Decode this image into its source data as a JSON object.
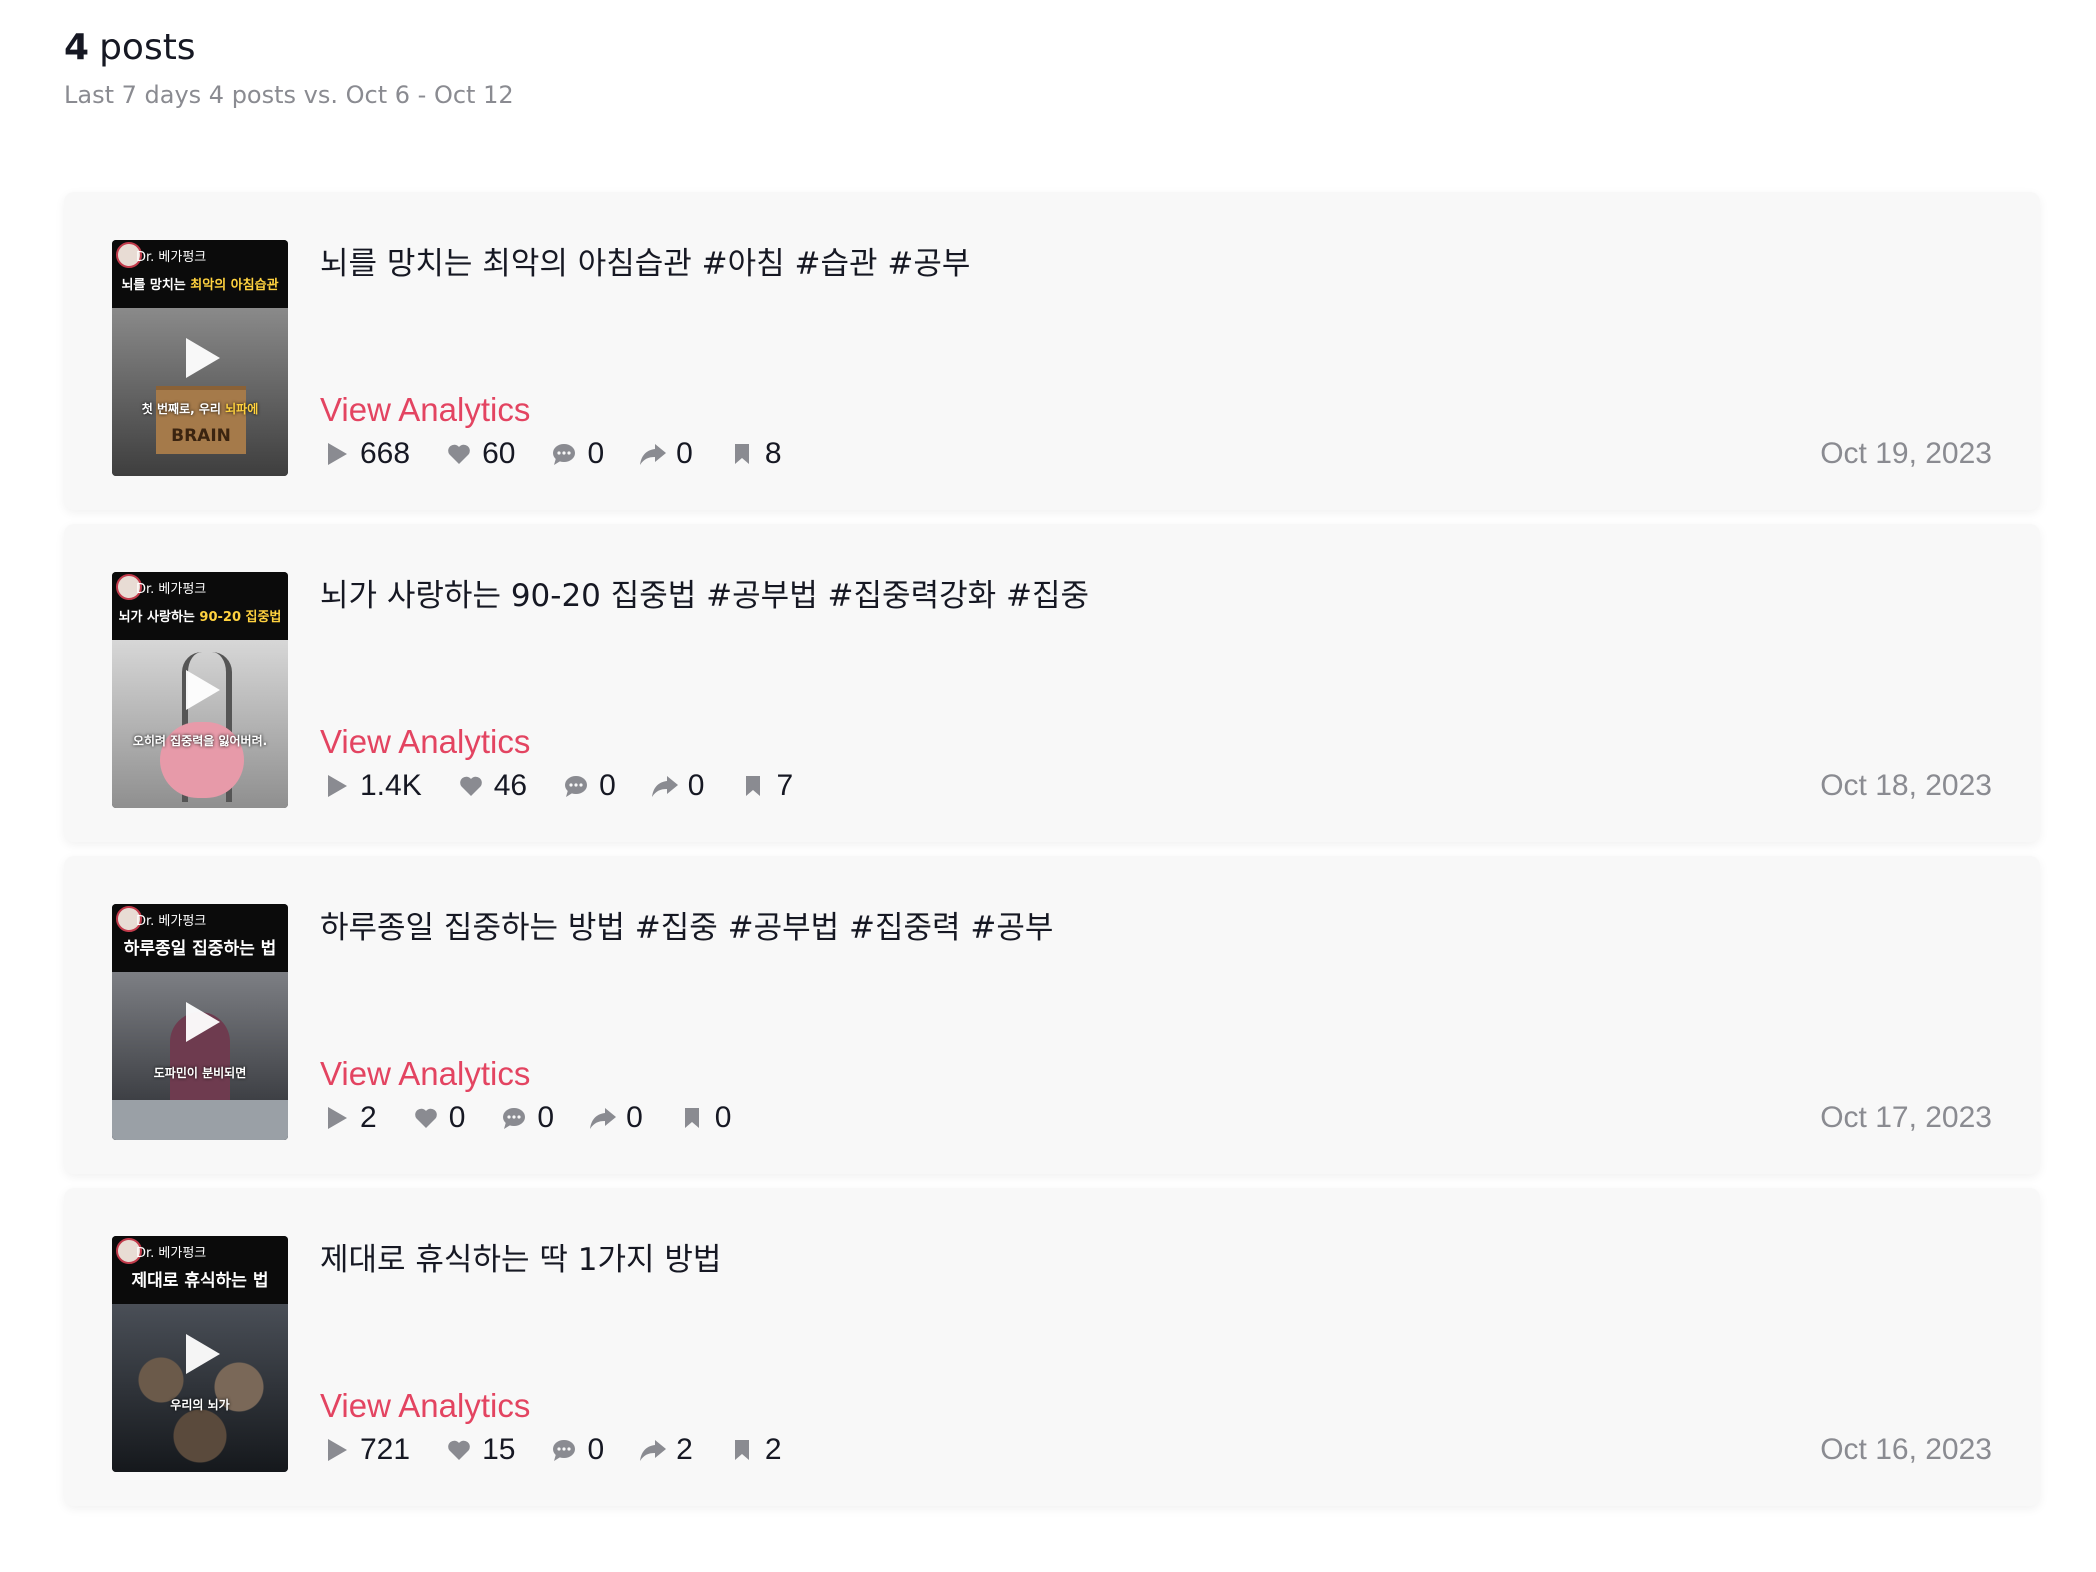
{
  "header": {
    "count_number": "4",
    "count_label": "posts",
    "subtitle": "Last 7 days 4 posts vs. Oct 6 - Oct 12"
  },
  "colors": {
    "accent": "#e34461",
    "muted": "#8a8b91",
    "card_bg": "#f8f8f8"
  },
  "posts": [
    {
      "title": "뇌를 망치는 최악의 아침습관 #아침 #습관 #공부",
      "link": "View Analytics",
      "views": "668",
      "likes": "60",
      "comments": "0",
      "shares": "0",
      "saves": "8",
      "date": "Oct 19, 2023",
      "thumb_brand": "Dr. 베가펑크",
      "thumb_title_a": "뇌를 망치는 ",
      "thumb_title_hl": "최악의 아침습관",
      "thumb_caption_a": "첫 번째로, 우리 ",
      "thumb_caption_hl": "뇌파에",
      "thumb_extra": "BRAIN"
    },
    {
      "title": "뇌가 사랑하는 90-20 집중법 #공부법 #집중력강화 #집중",
      "link": "View Analytics",
      "views": "1.4K",
      "likes": "46",
      "comments": "0",
      "shares": "0",
      "saves": "7",
      "date": "Oct 18, 2023",
      "thumb_brand": "Dr. 베가펑크",
      "thumb_title_a": "뇌가 사랑하는 ",
      "thumb_title_hl": "90-20 집중법",
      "thumb_caption_a": "오히려 집중력을 잃어버려.",
      "thumb_caption_hl": ""
    },
    {
      "title": "하루종일 집중하는 방법 #집중 #공부법 #집중력 #공부",
      "link": "View Analytics",
      "views": "2",
      "likes": "0",
      "comments": "0",
      "shares": "0",
      "saves": "0",
      "date": "Oct 17, 2023",
      "thumb_brand": "Dr. 베가펑크",
      "thumb_title_a": "하루종일 집중하는 법",
      "thumb_title_hl": "",
      "thumb_caption_a": "도파민이 분비되면",
      "thumb_caption_hl": ""
    },
    {
      "title": "제대로 휴식하는 딱 1가지 방법",
      "link": "View Analytics",
      "views": "721",
      "likes": "15",
      "comments": "0",
      "shares": "2",
      "saves": "2",
      "date": "Oct 16, 2023",
      "thumb_brand": "Dr. 베가펑크",
      "thumb_title_a": "제대로 휴식하는 법",
      "thumb_title_hl": "",
      "thumb_caption_a": "우리의 뇌가",
      "thumb_caption_hl": ""
    }
  ]
}
